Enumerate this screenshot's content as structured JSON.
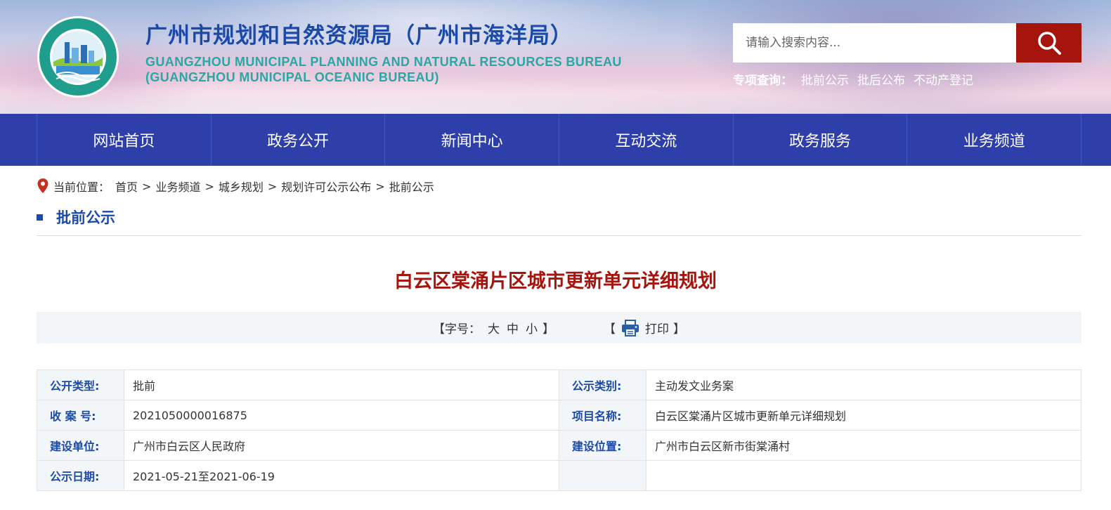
{
  "header": {
    "title_cn": "广州市规划和自然资源局（广州市海洋局）",
    "title_en_1": "GUANGZHOU MUNICIPAL PLANNING AND NATURAL RESOURCES BUREAU",
    "title_en_2": "(GUANGZHOU MUNICIPAL OCEANIC BUREAU)",
    "logo_icon": "bureau-logo-emblem",
    "search_placeholder": "请输入搜索内容...",
    "search_icon": "search-icon",
    "quick_label": "专项查询：",
    "quick_links": [
      "批前公示",
      "批后公布",
      "不动产登记"
    ]
  },
  "nav": {
    "items": [
      "网站首页",
      "政务公开",
      "新闻中心",
      "互动交流",
      "政务服务",
      "业务频道"
    ]
  },
  "breadcrumb": {
    "label": "当前位置：",
    "items": [
      "首页",
      "业务频道",
      "城乡规划",
      "规划许可公示公布",
      "批前公示"
    ],
    "separator": ">"
  },
  "section": {
    "title": "批前公示"
  },
  "article": {
    "title": "白云区棠涌片区城市更新单元详细规划",
    "font_size_label": "【字号：",
    "font_sizes": [
      "大",
      "中",
      "小"
    ],
    "font_size_close": "】",
    "print_open": "【",
    "print_label": "打印",
    "print_close": "】"
  },
  "info": {
    "rows": [
      {
        "k1": "公开类型:",
        "v1": "批前",
        "k2": "公示类别:",
        "v2": "主动发文业务案"
      },
      {
        "k1": "收 案 号:",
        "v1": "2021050000016875",
        "k2": "项目名称:",
        "v2": "白云区棠涌片区城市更新单元详细规划"
      },
      {
        "k1": "建设单位:",
        "v1": "广州市白云区人民政府",
        "k2": "建设位置:",
        "v2": "广州市白云区新市街棠涌村"
      },
      {
        "k1": "公示日期:",
        "v1": "2021-05-21至2021-06-19",
        "k2": "",
        "v2": ""
      }
    ]
  },
  "colors": {
    "nav_bg": "#2f3fa9",
    "brand_blue": "#1b4aa8",
    "accent_red": "#a5150e",
    "teal": "#2aa7a3"
  }
}
